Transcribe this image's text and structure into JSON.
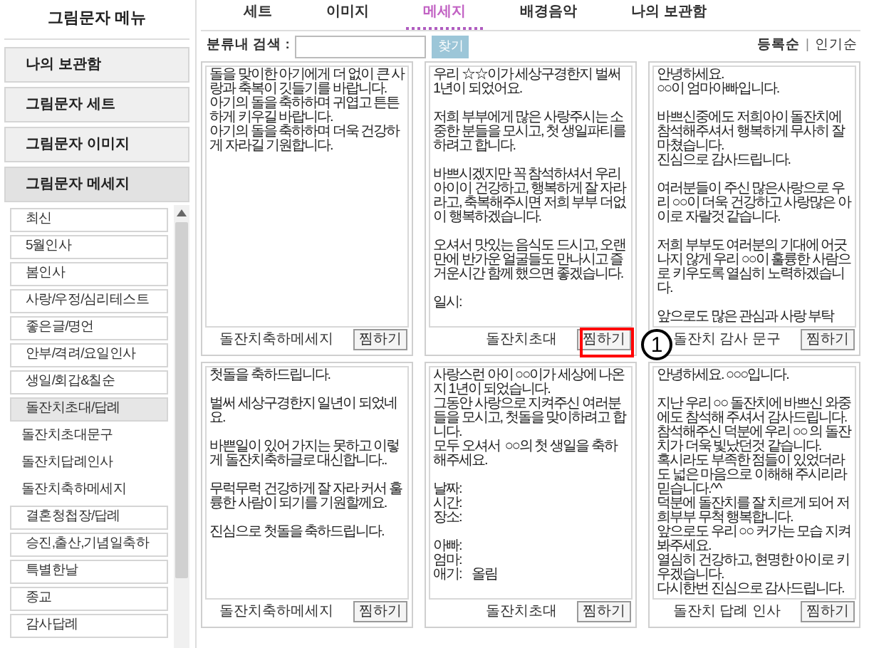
{
  "sidebar": {
    "title": "그림문자 메뉴",
    "sections": [
      {
        "label": "나의 보관함",
        "selected": false
      },
      {
        "label": "그림문자 세트",
        "selected": false
      },
      {
        "label": "그림문자 이미지",
        "selected": false
      },
      {
        "label": "그림문자 메세지",
        "selected": true
      }
    ],
    "items": [
      {
        "label": "최신",
        "kind": "category",
        "selected": false
      },
      {
        "label": "5월인사",
        "kind": "category",
        "selected": false
      },
      {
        "label": "봄인사",
        "kind": "category",
        "selected": false
      },
      {
        "label": "사랑/우정/심리테스트",
        "kind": "category",
        "selected": false
      },
      {
        "label": "좋은글/명언",
        "kind": "category",
        "selected": false
      },
      {
        "label": "안부/격려/요일인사",
        "kind": "category",
        "selected": false
      },
      {
        "label": "생일/회갑&칠순",
        "kind": "category",
        "selected": false
      },
      {
        "label": "돌잔치초대/답례",
        "kind": "category",
        "selected": true
      },
      {
        "label": "돌잔치초대문구",
        "kind": "sub",
        "selected": false
      },
      {
        "label": "돌잔치답례인사",
        "kind": "sub",
        "selected": false
      },
      {
        "label": "돌잔치축하메세지",
        "kind": "sub",
        "selected": false
      },
      {
        "label": "결혼청첩장/답례",
        "kind": "category",
        "selected": false
      },
      {
        "label": "승진,출산,기념일축하",
        "kind": "category",
        "selected": false
      },
      {
        "label": "특별한날",
        "kind": "category",
        "selected": false
      },
      {
        "label": "종교",
        "kind": "category",
        "selected": false
      },
      {
        "label": "감사답례",
        "kind": "category",
        "selected": false
      }
    ]
  },
  "tabs": [
    {
      "label": "세트",
      "selected": false
    },
    {
      "label": "이미지",
      "selected": false
    },
    {
      "label": "메세지",
      "selected": true
    },
    {
      "label": "배경음악",
      "selected": false
    },
    {
      "label": "나의 보관함",
      "selected": false
    }
  ],
  "search": {
    "label": "분류내 검색 :",
    "button": "찾기"
  },
  "sort": {
    "options": [
      "등록순",
      "인기순"
    ],
    "separator": "|"
  },
  "cards": [
    {
      "text": "돌을 맞이한 아기에게 더 없이 큰 사랑과 축복이 깃들기를 바랍니다.\n아기의 돌을 축하하며 귀엽고 튼튼하게 키우길 바랍니다.\n아기의 돌을 축하하며 더욱 건강하게 자라길 기원합니다.",
      "caption": "돌잔치축하메세지",
      "button": "찜하기",
      "annotated": false
    },
    {
      "text": "우리 ☆☆이가 세상구경한지 벌써 1년이 되었어요.\n\n저희 부부에게 많은 사랑주시는 소중한 분들을 모시고, 첫 생일파티를 하려고 합니다.\n\n바쁘시겠지만 꼭 참석하셔서 우리 아이이 건강하고, 행복하게 잘 자라라고, 축복해주시면 저희 부부 더없이 행복하겠습니다.\n\n오셔서 맛있는 음식도 드시고, 오랜만에 반가운 얼굴들도 만나시고 즐거운시간 함께 했으면 좋겠습니다.\n\n일시:",
      "caption": "돌잔치초대",
      "button": "찜하기",
      "annotated": true
    },
    {
      "text": "안녕하세요.\n○○이 엄마아빠입니다.\n\n바쁘신중에도 저희아이 돌잔치에 참석해주셔서 행복하게 무사히 잘 마쳤습니다.\n진심으로 감사드립니다.\n\n여러분들이 주신 많은사랑으로 우리 ○○이 더욱 건강하고 사랑많은 아이로 자랄것 같습니다.\n\n저희 부부도 여러분의 기대에 어긋나지 않게 우리 ○○이 훌륭한 사람으로 키우도록 열심히 노력하겠습니다.\n\n앞으로도 많은 관심과 사랑 부탁",
      "caption": "돌잔치 감사 문구",
      "button": "찜하기",
      "annotated": false
    },
    {
      "text": "첫돌을 축하드립니다.\n\n벌써 세상구경한지 일년이 되었네요.\n\n바쁜일이 있어 가지는 못하고 이렇게 돌잔치축하글로 대신합니다..\n\n무럭무럭 건강하게 잘 자라 커서 훌륭한 사람이 되기를 기원할께요.\n\n진심으로 첫돌을 축하드립니다.",
      "caption": "돌잔치축하메세지",
      "button": "찜하기",
      "annotated": false
    },
    {
      "text": "사랑스런 아이 ○○이가 세상에 나온지 1년이 되었습니다.\n그동안 사랑으로 지켜주신 여러분들을 모시고, 첫돌을 맞이하려고 합니다.\n모두 오셔서  ○○의 첫 생일을 축하해주세요.\n\n날짜:\n시간:\n장소:\n\n아빠:\n엄마:\n애기:    올림",
      "caption": "돌잔치초대",
      "button": "찜하기",
      "annotated": false
    },
    {
      "text": "안녕하세요. ○○○입니다.\n\n지난 우리 ○○ 돌잔치에 바쁘신 와중에도 참석해 주셔서 감사드립니다.\n참석해주신 덕분에 우리 ○○ 의 돌잔치가 더욱 빛났던것 같습니다.\n혹시라도 부족한 점들이 있었더라도 넓은 마음으로 이해해 주시리라 믿습니다.^^\n덕분에 돌잔치를 잘 치르게 되어 저희부부 무척 행복합니다.\n앞으로도 우리 ○○ 커가는 모습 지켜봐주세요.\n열심히 건강하고, 현명한 아이로 키우겠습니다.\n다시한번 진심으로 감사드립니다.",
      "caption": "돌잔치 답례 인사",
      "button": "찜하기",
      "annotated": false
    }
  ],
  "annotation": {
    "label": "1"
  }
}
